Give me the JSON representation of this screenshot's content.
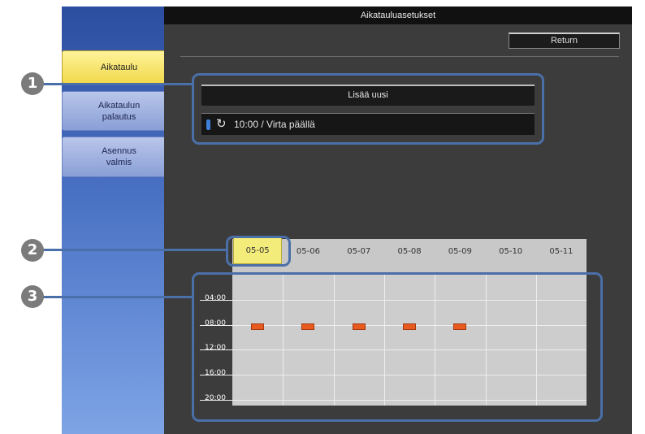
{
  "titlebar": {
    "title": "Aikatauluasetukset"
  },
  "return_button": {
    "label": "Return"
  },
  "sidebar": {
    "tabs": [
      {
        "label": "Aikataulu",
        "active": true
      },
      {
        "label": "Aikataulun\npalautus",
        "active": false
      },
      {
        "label": "Asennus\nvalmis",
        "active": false
      }
    ]
  },
  "schedule_list": {
    "add_new_label": "Lisää uusi",
    "entries": [
      {
        "text": "10:00 / Virta päällä",
        "icon": "repeat-icon"
      }
    ]
  },
  "callouts": [
    "1",
    "2",
    "3"
  ],
  "calendar": {
    "days": [
      "05-05",
      "05-06",
      "05-07",
      "05-08",
      "05-09",
      "05-10",
      "05-11"
    ],
    "selected_day": "05-05",
    "time_ticks": [
      "04:00",
      "08:00",
      "12:00",
      "16:00",
      "20:00"
    ],
    "events": [
      {
        "day": "05-05",
        "time": "10:00"
      },
      {
        "day": "05-06",
        "time": "10:00"
      },
      {
        "day": "05-07",
        "time": "10:00"
      },
      {
        "day": "05-08",
        "time": "10:00"
      },
      {
        "day": "05-09",
        "time": "10:00"
      }
    ]
  },
  "colors": {
    "accent_yellow": "#f4ec7a",
    "event_orange": "#e85a1e",
    "callout_blue": "#4b6fa8"
  }
}
